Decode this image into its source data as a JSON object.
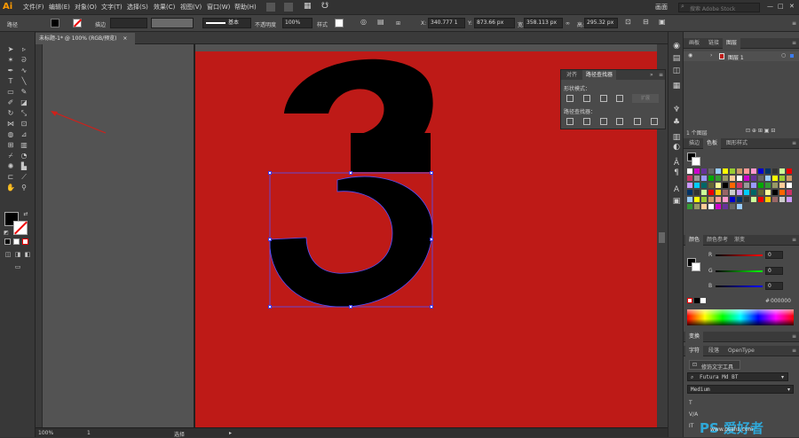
{
  "app": {
    "logo": "Ai"
  },
  "menu": [
    "文件(F)",
    "编辑(E)",
    "对象(O)",
    "文字(T)",
    "选择(S)",
    "效果(C)",
    "视图(V)",
    "窗口(W)",
    "帮助(H)"
  ],
  "menubar_right": {
    "workspace": "画面",
    "search_placeholder": "搜索 Adobe Stock"
  },
  "control": {
    "object_type": "路径",
    "stroke_label": "描边",
    "brush": "基本",
    "opacity_label": "不透明度",
    "opacity": "100%",
    "style_label": "样式",
    "x": "340.777 1",
    "y": "873.66 px",
    "w": "358.113 px",
    "h": "295.32 px"
  },
  "doc_tab": {
    "label": "未标题-1* @ 100% (RGB/预览)",
    "close": "×"
  },
  "status": {
    "zoom": "100%",
    "page": "1",
    "tool_hint": "选择"
  },
  "artwork": {
    "glyph": "3",
    "background": "#be1a17",
    "glyph_color": "#000000"
  },
  "pathfinder": {
    "tabs": [
      "对齐",
      "路径查找器"
    ],
    "shape_modes": "形状模式：",
    "pathfinders": "路径查找器：",
    "expand": "扩展"
  },
  "layers": {
    "tabs": [
      "画板",
      "链接",
      "图层"
    ],
    "layer_name": "图层 1",
    "count": "1 个图层"
  },
  "swatches": {
    "tabs": [
      "描边",
      "色板",
      "图形样式"
    ]
  },
  "color": {
    "tabs": [
      "颜色",
      "颜色参考",
      "渐变"
    ],
    "r_label": "R",
    "g_label": "G",
    "b_label": "B",
    "r": "0",
    "g": "0",
    "b": "0",
    "hex": "000000"
  },
  "transform": {
    "tab": "变换"
  },
  "character": {
    "tabs": [
      "字符",
      "段落",
      "OpenType"
    ],
    "tool": "修饰文字工具",
    "font": "Futura Md BT",
    "style": "Medium"
  },
  "watermark": {
    "brand": "PS 爱好者",
    "url": "www.psahz.com"
  }
}
